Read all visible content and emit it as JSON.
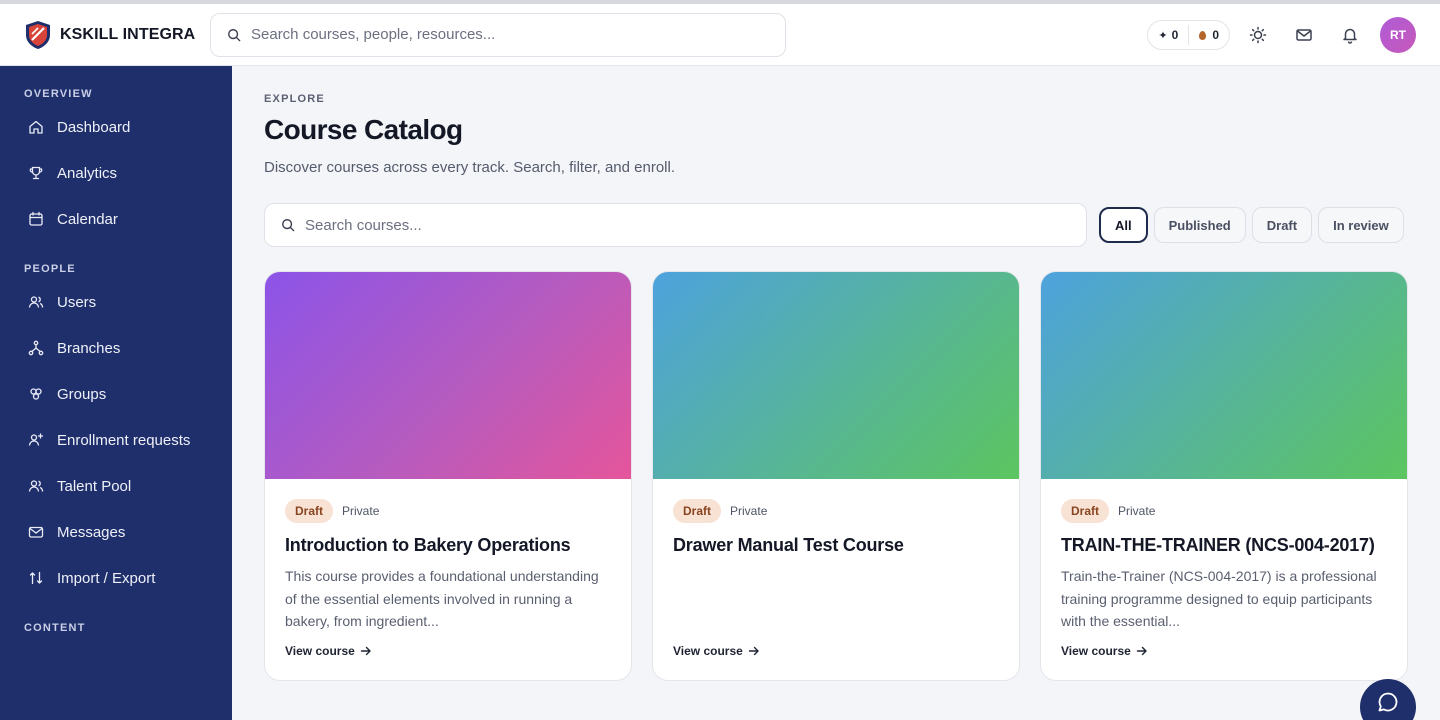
{
  "app": {
    "name": "KSKILL INTEGRA"
  },
  "header": {
    "search_placeholder": "Search courses, people, resources...",
    "counters": [
      {
        "icon": "sparkle-icon",
        "value": "0"
      },
      {
        "icon": "drop-icon",
        "value": "0"
      }
    ],
    "user_initials": "RT"
  },
  "sidebar": {
    "sections": [
      {
        "label": "OVERVIEW",
        "items": [
          {
            "label": "Dashboard",
            "icon": "home-icon"
          },
          {
            "label": "Analytics",
            "icon": "trophy-icon"
          },
          {
            "label": "Calendar",
            "icon": "calendar-icon"
          }
        ]
      },
      {
        "label": "PEOPLE",
        "items": [
          {
            "label": "Users",
            "icon": "users-icon"
          },
          {
            "label": "Branches",
            "icon": "branches-icon"
          },
          {
            "label": "Groups",
            "icon": "groups-icon"
          },
          {
            "label": "Enrollment requests",
            "icon": "user-plus-icon"
          },
          {
            "label": "Talent Pool",
            "icon": "talent-icon"
          },
          {
            "label": "Messages",
            "icon": "mail-icon"
          },
          {
            "label": "Import / Export",
            "icon": "import-export-icon"
          }
        ]
      },
      {
        "label": "CONTENT",
        "items": []
      }
    ]
  },
  "main": {
    "eyebrow": "EXPLORE",
    "title": "Course Catalog",
    "subtitle": "Discover courses across every track. Search, filter, and enroll.",
    "search_placeholder": "Search courses...",
    "filters": [
      {
        "label": "All",
        "active": true
      },
      {
        "label": "Published",
        "active": false
      },
      {
        "label": "Draft",
        "active": false
      },
      {
        "label": "In review",
        "active": false
      }
    ],
    "courses": [
      {
        "status": "Draft",
        "visibility": "Private",
        "title": "Introduction to Bakery Operations",
        "description": "This course provides a foundational understanding of the essential elements involved in running a bakery, from ingredient...",
        "link": "View course"
      },
      {
        "status": "Draft",
        "visibility": "Private",
        "title": "Drawer Manual Test Course",
        "description": "",
        "link": "View course"
      },
      {
        "status": "Draft",
        "visibility": "Private",
        "title": "TRAIN-THE-TRAINER (NCS-004-2017)",
        "description": "Train-the-Trainer (NCS-004-2017) is a professional training programme designed to equip participants with the essential...",
        "link": "View course"
      }
    ]
  },
  "colors": {
    "sidebar_bg": "#1f2f6b",
    "draft_badge_bg": "#f8e2d4",
    "draft_badge_text": "#8a4420",
    "avatar_bg": "#b05ad8"
  }
}
